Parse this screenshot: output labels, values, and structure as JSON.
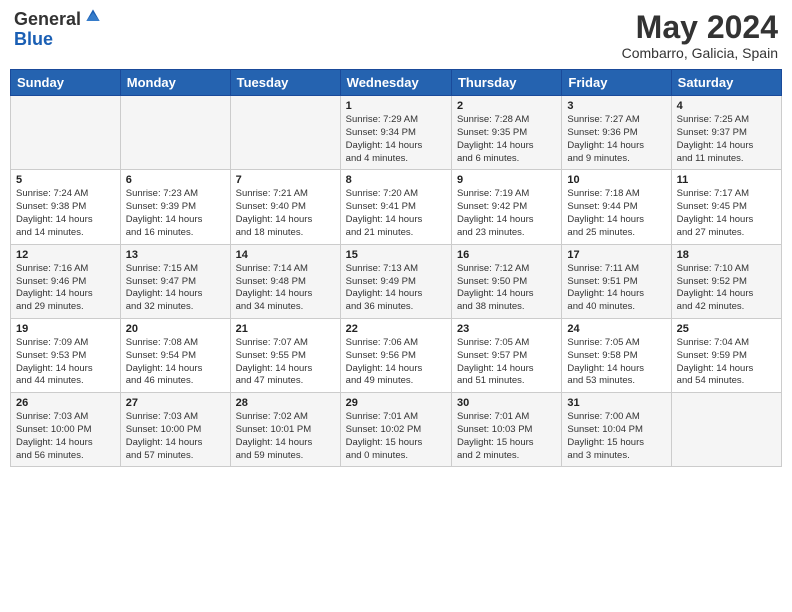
{
  "header": {
    "logo_general": "General",
    "logo_blue": "Blue",
    "month_year": "May 2024",
    "location": "Combarro, Galicia, Spain"
  },
  "weekdays": [
    "Sunday",
    "Monday",
    "Tuesday",
    "Wednesday",
    "Thursday",
    "Friday",
    "Saturday"
  ],
  "weeks": [
    [
      {
        "day": "",
        "info": ""
      },
      {
        "day": "",
        "info": ""
      },
      {
        "day": "",
        "info": ""
      },
      {
        "day": "1",
        "info": "Sunrise: 7:29 AM\nSunset: 9:34 PM\nDaylight: 14 hours\nand 4 minutes."
      },
      {
        "day": "2",
        "info": "Sunrise: 7:28 AM\nSunset: 9:35 PM\nDaylight: 14 hours\nand 6 minutes."
      },
      {
        "day": "3",
        "info": "Sunrise: 7:27 AM\nSunset: 9:36 PM\nDaylight: 14 hours\nand 9 minutes."
      },
      {
        "day": "4",
        "info": "Sunrise: 7:25 AM\nSunset: 9:37 PM\nDaylight: 14 hours\nand 11 minutes."
      }
    ],
    [
      {
        "day": "5",
        "info": "Sunrise: 7:24 AM\nSunset: 9:38 PM\nDaylight: 14 hours\nand 14 minutes."
      },
      {
        "day": "6",
        "info": "Sunrise: 7:23 AM\nSunset: 9:39 PM\nDaylight: 14 hours\nand 16 minutes."
      },
      {
        "day": "7",
        "info": "Sunrise: 7:21 AM\nSunset: 9:40 PM\nDaylight: 14 hours\nand 18 minutes."
      },
      {
        "day": "8",
        "info": "Sunrise: 7:20 AM\nSunset: 9:41 PM\nDaylight: 14 hours\nand 21 minutes."
      },
      {
        "day": "9",
        "info": "Sunrise: 7:19 AM\nSunset: 9:42 PM\nDaylight: 14 hours\nand 23 minutes."
      },
      {
        "day": "10",
        "info": "Sunrise: 7:18 AM\nSunset: 9:44 PM\nDaylight: 14 hours\nand 25 minutes."
      },
      {
        "day": "11",
        "info": "Sunrise: 7:17 AM\nSunset: 9:45 PM\nDaylight: 14 hours\nand 27 minutes."
      }
    ],
    [
      {
        "day": "12",
        "info": "Sunrise: 7:16 AM\nSunset: 9:46 PM\nDaylight: 14 hours\nand 29 minutes."
      },
      {
        "day": "13",
        "info": "Sunrise: 7:15 AM\nSunset: 9:47 PM\nDaylight: 14 hours\nand 32 minutes."
      },
      {
        "day": "14",
        "info": "Sunrise: 7:14 AM\nSunset: 9:48 PM\nDaylight: 14 hours\nand 34 minutes."
      },
      {
        "day": "15",
        "info": "Sunrise: 7:13 AM\nSunset: 9:49 PM\nDaylight: 14 hours\nand 36 minutes."
      },
      {
        "day": "16",
        "info": "Sunrise: 7:12 AM\nSunset: 9:50 PM\nDaylight: 14 hours\nand 38 minutes."
      },
      {
        "day": "17",
        "info": "Sunrise: 7:11 AM\nSunset: 9:51 PM\nDaylight: 14 hours\nand 40 minutes."
      },
      {
        "day": "18",
        "info": "Sunrise: 7:10 AM\nSunset: 9:52 PM\nDaylight: 14 hours\nand 42 minutes."
      }
    ],
    [
      {
        "day": "19",
        "info": "Sunrise: 7:09 AM\nSunset: 9:53 PM\nDaylight: 14 hours\nand 44 minutes."
      },
      {
        "day": "20",
        "info": "Sunrise: 7:08 AM\nSunset: 9:54 PM\nDaylight: 14 hours\nand 46 minutes."
      },
      {
        "day": "21",
        "info": "Sunrise: 7:07 AM\nSunset: 9:55 PM\nDaylight: 14 hours\nand 47 minutes."
      },
      {
        "day": "22",
        "info": "Sunrise: 7:06 AM\nSunset: 9:56 PM\nDaylight: 14 hours\nand 49 minutes."
      },
      {
        "day": "23",
        "info": "Sunrise: 7:05 AM\nSunset: 9:57 PM\nDaylight: 14 hours\nand 51 minutes."
      },
      {
        "day": "24",
        "info": "Sunrise: 7:05 AM\nSunset: 9:58 PM\nDaylight: 14 hours\nand 53 minutes."
      },
      {
        "day": "25",
        "info": "Sunrise: 7:04 AM\nSunset: 9:59 PM\nDaylight: 14 hours\nand 54 minutes."
      }
    ],
    [
      {
        "day": "26",
        "info": "Sunrise: 7:03 AM\nSunset: 10:00 PM\nDaylight: 14 hours\nand 56 minutes."
      },
      {
        "day": "27",
        "info": "Sunrise: 7:03 AM\nSunset: 10:00 PM\nDaylight: 14 hours\nand 57 minutes."
      },
      {
        "day": "28",
        "info": "Sunrise: 7:02 AM\nSunset: 10:01 PM\nDaylight: 14 hours\nand 59 minutes."
      },
      {
        "day": "29",
        "info": "Sunrise: 7:01 AM\nSunset: 10:02 PM\nDaylight: 15 hours\nand 0 minutes."
      },
      {
        "day": "30",
        "info": "Sunrise: 7:01 AM\nSunset: 10:03 PM\nDaylight: 15 hours\nand 2 minutes."
      },
      {
        "day": "31",
        "info": "Sunrise: 7:00 AM\nSunset: 10:04 PM\nDaylight: 15 hours\nand 3 minutes."
      },
      {
        "day": "",
        "info": ""
      }
    ]
  ]
}
